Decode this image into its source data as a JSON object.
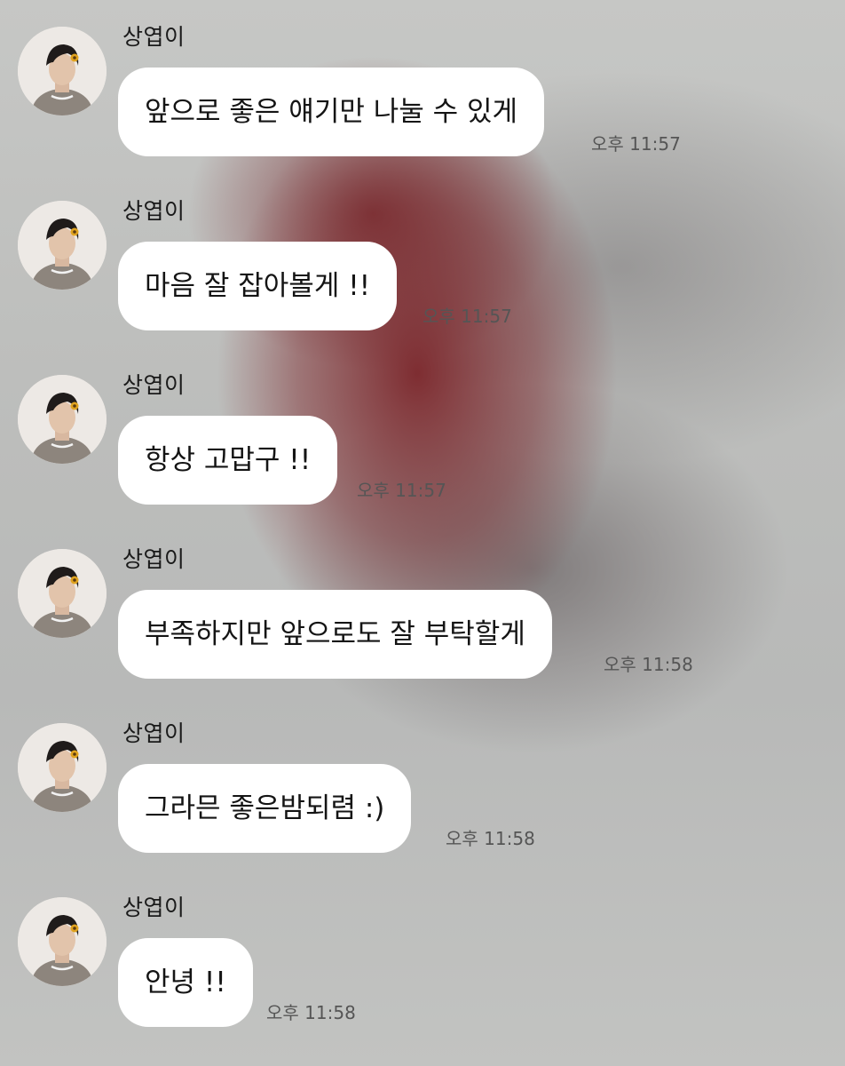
{
  "chat": {
    "messages": [
      {
        "sender": "상엽이",
        "text": "앞으로 좋은 얘기만 나눌 수 있게",
        "time": "오후 11:57"
      },
      {
        "sender": "상엽이",
        "text": "마음 잘 잡아볼게 !!",
        "time": "오후 11:57"
      },
      {
        "sender": "상엽이",
        "text": "항상 고맙구 !!",
        "time": "오후 11:57"
      },
      {
        "sender": "상엽이",
        "text": "부족하지만 앞으로도 잘 부탁할게",
        "time": "오후 11:58"
      },
      {
        "sender": "상엽이",
        "text": "그라믄 좋은밤되렴 :)",
        "time": "오후 11:58"
      },
      {
        "sender": "상엽이",
        "text": "안녕 !!",
        "time": "오후 11:58"
      }
    ]
  },
  "colors": {
    "bubble": "#ffffff",
    "background": "#bdbebc",
    "timestamp": "#555555",
    "sender": "#1a1a1a"
  },
  "icons": {
    "avatar": "profile-photo"
  }
}
